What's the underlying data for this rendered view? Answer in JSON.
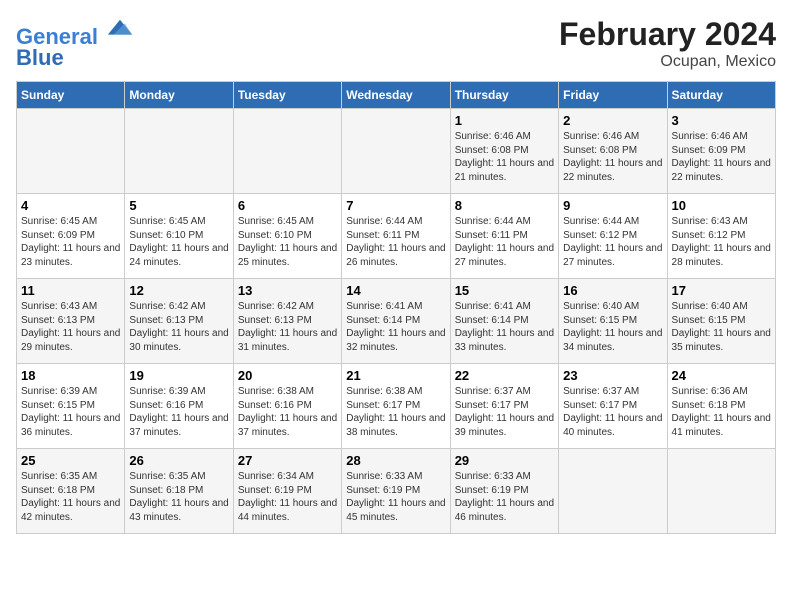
{
  "logo": {
    "line1": "General",
    "line2": "Blue"
  },
  "title": "February 2024",
  "subtitle": "Ocupan, Mexico",
  "days_of_week": [
    "Sunday",
    "Monday",
    "Tuesday",
    "Wednesday",
    "Thursday",
    "Friday",
    "Saturday"
  ],
  "weeks": [
    [
      {
        "day": "",
        "info": ""
      },
      {
        "day": "",
        "info": ""
      },
      {
        "day": "",
        "info": ""
      },
      {
        "day": "",
        "info": ""
      },
      {
        "day": "1",
        "info": "Sunrise: 6:46 AM\nSunset: 6:08 PM\nDaylight: 11 hours and 21 minutes."
      },
      {
        "day": "2",
        "info": "Sunrise: 6:46 AM\nSunset: 6:08 PM\nDaylight: 11 hours and 22 minutes."
      },
      {
        "day": "3",
        "info": "Sunrise: 6:46 AM\nSunset: 6:09 PM\nDaylight: 11 hours and 22 minutes."
      }
    ],
    [
      {
        "day": "4",
        "info": "Sunrise: 6:45 AM\nSunset: 6:09 PM\nDaylight: 11 hours and 23 minutes."
      },
      {
        "day": "5",
        "info": "Sunrise: 6:45 AM\nSunset: 6:10 PM\nDaylight: 11 hours and 24 minutes."
      },
      {
        "day": "6",
        "info": "Sunrise: 6:45 AM\nSunset: 6:10 PM\nDaylight: 11 hours and 25 minutes."
      },
      {
        "day": "7",
        "info": "Sunrise: 6:44 AM\nSunset: 6:11 PM\nDaylight: 11 hours and 26 minutes."
      },
      {
        "day": "8",
        "info": "Sunrise: 6:44 AM\nSunset: 6:11 PM\nDaylight: 11 hours and 27 minutes."
      },
      {
        "day": "9",
        "info": "Sunrise: 6:44 AM\nSunset: 6:12 PM\nDaylight: 11 hours and 27 minutes."
      },
      {
        "day": "10",
        "info": "Sunrise: 6:43 AM\nSunset: 6:12 PM\nDaylight: 11 hours and 28 minutes."
      }
    ],
    [
      {
        "day": "11",
        "info": "Sunrise: 6:43 AM\nSunset: 6:13 PM\nDaylight: 11 hours and 29 minutes."
      },
      {
        "day": "12",
        "info": "Sunrise: 6:42 AM\nSunset: 6:13 PM\nDaylight: 11 hours and 30 minutes."
      },
      {
        "day": "13",
        "info": "Sunrise: 6:42 AM\nSunset: 6:13 PM\nDaylight: 11 hours and 31 minutes."
      },
      {
        "day": "14",
        "info": "Sunrise: 6:41 AM\nSunset: 6:14 PM\nDaylight: 11 hours and 32 minutes."
      },
      {
        "day": "15",
        "info": "Sunrise: 6:41 AM\nSunset: 6:14 PM\nDaylight: 11 hours and 33 minutes."
      },
      {
        "day": "16",
        "info": "Sunrise: 6:40 AM\nSunset: 6:15 PM\nDaylight: 11 hours and 34 minutes."
      },
      {
        "day": "17",
        "info": "Sunrise: 6:40 AM\nSunset: 6:15 PM\nDaylight: 11 hours and 35 minutes."
      }
    ],
    [
      {
        "day": "18",
        "info": "Sunrise: 6:39 AM\nSunset: 6:15 PM\nDaylight: 11 hours and 36 minutes."
      },
      {
        "day": "19",
        "info": "Sunrise: 6:39 AM\nSunset: 6:16 PM\nDaylight: 11 hours and 37 minutes."
      },
      {
        "day": "20",
        "info": "Sunrise: 6:38 AM\nSunset: 6:16 PM\nDaylight: 11 hours and 37 minutes."
      },
      {
        "day": "21",
        "info": "Sunrise: 6:38 AM\nSunset: 6:17 PM\nDaylight: 11 hours and 38 minutes."
      },
      {
        "day": "22",
        "info": "Sunrise: 6:37 AM\nSunset: 6:17 PM\nDaylight: 11 hours and 39 minutes."
      },
      {
        "day": "23",
        "info": "Sunrise: 6:37 AM\nSunset: 6:17 PM\nDaylight: 11 hours and 40 minutes."
      },
      {
        "day": "24",
        "info": "Sunrise: 6:36 AM\nSunset: 6:18 PM\nDaylight: 11 hours and 41 minutes."
      }
    ],
    [
      {
        "day": "25",
        "info": "Sunrise: 6:35 AM\nSunset: 6:18 PM\nDaylight: 11 hours and 42 minutes."
      },
      {
        "day": "26",
        "info": "Sunrise: 6:35 AM\nSunset: 6:18 PM\nDaylight: 11 hours and 43 minutes."
      },
      {
        "day": "27",
        "info": "Sunrise: 6:34 AM\nSunset: 6:19 PM\nDaylight: 11 hours and 44 minutes."
      },
      {
        "day": "28",
        "info": "Sunrise: 6:33 AM\nSunset: 6:19 PM\nDaylight: 11 hours and 45 minutes."
      },
      {
        "day": "29",
        "info": "Sunrise: 6:33 AM\nSunset: 6:19 PM\nDaylight: 11 hours and 46 minutes."
      },
      {
        "day": "",
        "info": ""
      },
      {
        "day": "",
        "info": ""
      }
    ]
  ]
}
